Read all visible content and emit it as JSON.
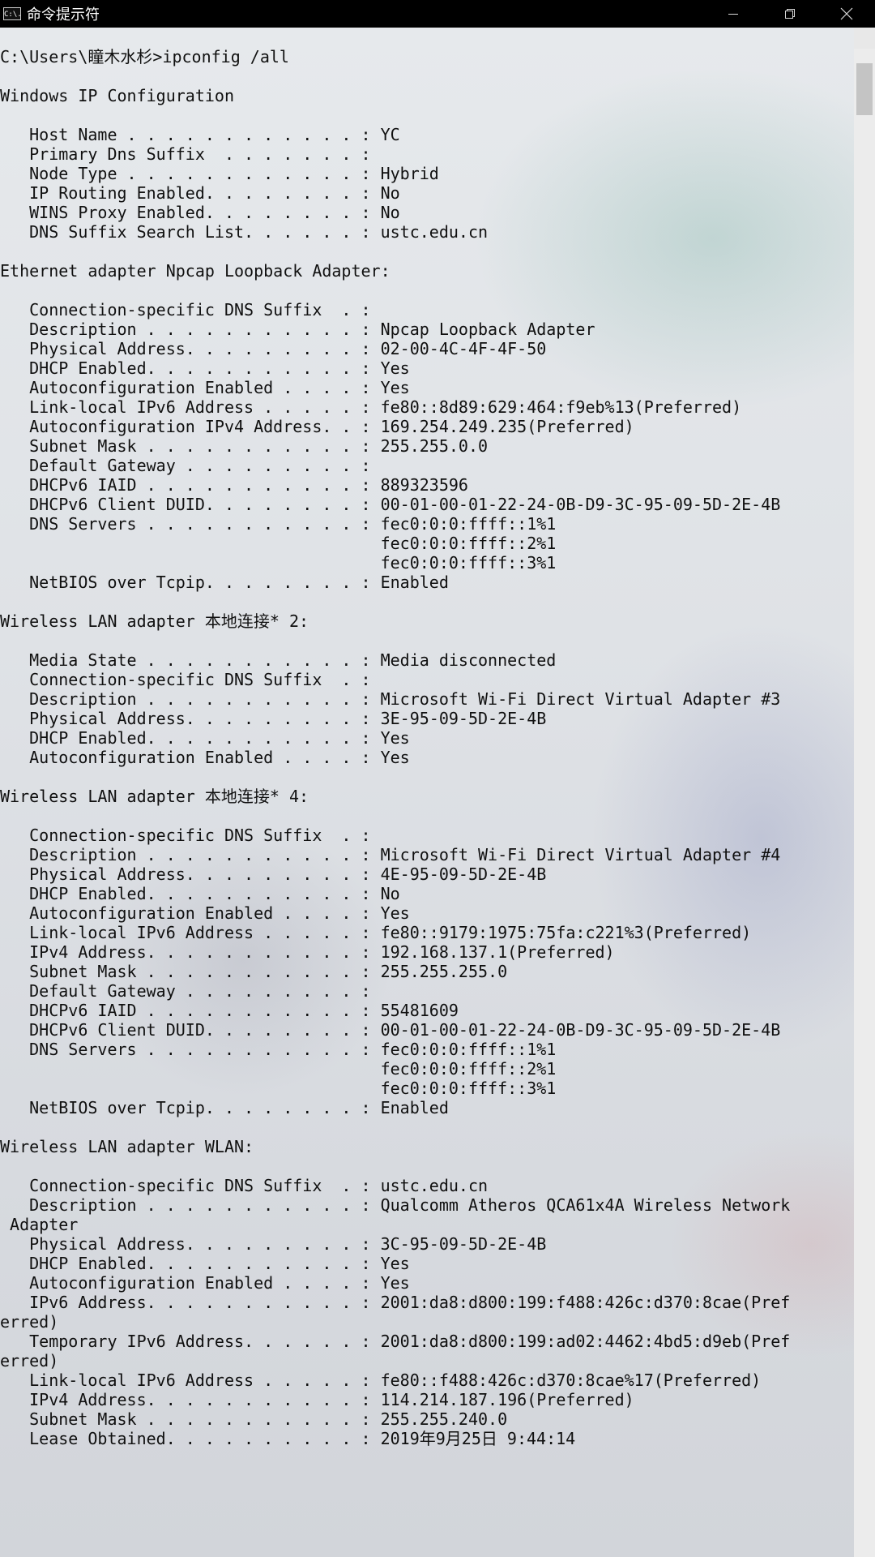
{
  "window": {
    "title": "命令提示符",
    "icon": "cmd-icon",
    "icon_text": "C:\\.",
    "controls": [
      "minimize-icon",
      "restore-icon",
      "close-icon"
    ]
  },
  "console": {
    "lines": [
      "",
      "C:\\Users\\瞳木水杉>ipconfig /all",
      "",
      "Windows IP Configuration",
      "",
      "   Host Name . . . . . . . . . . . . : YC",
      "   Primary Dns Suffix  . . . . . . . :",
      "   Node Type . . . . . . . . . . . . : Hybrid",
      "   IP Routing Enabled. . . . . . . . : No",
      "   WINS Proxy Enabled. . . . . . . . : No",
      "   DNS Suffix Search List. . . . . . : ustc.edu.cn",
      "",
      "Ethernet adapter Npcap Loopback Adapter:",
      "",
      "   Connection-specific DNS Suffix  . :",
      "   Description . . . . . . . . . . . : Npcap Loopback Adapter",
      "   Physical Address. . . . . . . . . : 02-00-4C-4F-4F-50",
      "   DHCP Enabled. . . . . . . . . . . : Yes",
      "   Autoconfiguration Enabled . . . . : Yes",
      "   Link-local IPv6 Address . . . . . : fe80::8d89:629:464:f9eb%13(Preferred)",
      "   Autoconfiguration IPv4 Address. . : 169.254.249.235(Preferred)",
      "   Subnet Mask . . . . . . . . . . . : 255.255.0.0",
      "   Default Gateway . . . . . . . . . :",
      "   DHCPv6 IAID . . . . . . . . . . . : 889323596",
      "   DHCPv6 Client DUID. . . . . . . . : 00-01-00-01-22-24-0B-D9-3C-95-09-5D-2E-4B",
      "   DNS Servers . . . . . . . . . . . : fec0:0:0:ffff::1%1",
      "                                       fec0:0:0:ffff::2%1",
      "                                       fec0:0:0:ffff::3%1",
      "   NetBIOS over Tcpip. . . . . . . . : Enabled",
      "",
      "Wireless LAN adapter 本地连接* 2:",
      "",
      "   Media State . . . . . . . . . . . : Media disconnected",
      "   Connection-specific DNS Suffix  . :",
      "   Description . . . . . . . . . . . : Microsoft Wi-Fi Direct Virtual Adapter #3",
      "   Physical Address. . . . . . . . . : 3E-95-09-5D-2E-4B",
      "   DHCP Enabled. . . . . . . . . . . : Yes",
      "   Autoconfiguration Enabled . . . . : Yes",
      "",
      "Wireless LAN adapter 本地连接* 4:",
      "",
      "   Connection-specific DNS Suffix  . :",
      "   Description . . . . . . . . . . . : Microsoft Wi-Fi Direct Virtual Adapter #4",
      "   Physical Address. . . . . . . . . : 4E-95-09-5D-2E-4B",
      "   DHCP Enabled. . . . . . . . . . . : No",
      "   Autoconfiguration Enabled . . . . : Yes",
      "   Link-local IPv6 Address . . . . . : fe80::9179:1975:75fa:c221%3(Preferred)",
      "   IPv4 Address. . . . . . . . . . . : 192.168.137.1(Preferred)",
      "   Subnet Mask . . . . . . . . . . . : 255.255.255.0",
      "   Default Gateway . . . . . . . . . :",
      "   DHCPv6 IAID . . . . . . . . . . . : 55481609",
      "   DHCPv6 Client DUID. . . . . . . . : 00-01-00-01-22-24-0B-D9-3C-95-09-5D-2E-4B",
      "   DNS Servers . . . . . . . . . . . : fec0:0:0:ffff::1%1",
      "                                       fec0:0:0:ffff::2%1",
      "                                       fec0:0:0:ffff::3%1",
      "   NetBIOS over Tcpip. . . . . . . . : Enabled",
      "",
      "Wireless LAN adapter WLAN:",
      "",
      "   Connection-specific DNS Suffix  . : ustc.edu.cn",
      "   Description . . . . . . . . . . . : Qualcomm Atheros QCA61x4A Wireless Network",
      " Adapter",
      "   Physical Address. . . . . . . . . : 3C-95-09-5D-2E-4B",
      "   DHCP Enabled. . . . . . . . . . . : Yes",
      "   Autoconfiguration Enabled . . . . : Yes",
      "   IPv6 Address. . . . . . . . . . . : 2001:da8:d800:199:f488:426c:d370:8cae(Pref",
      "erred)",
      "   Temporary IPv6 Address. . . . . . : 2001:da8:d800:199:ad02:4462:4bd5:d9eb(Pref",
      "erred)",
      "   Link-local IPv6 Address . . . . . : fe80::f488:426c:d370:8cae%17(Preferred)",
      "   IPv4 Address. . . . . . . . . . . : 114.214.187.196(Preferred)",
      "   Subnet Mask . . . . . . . . . . . : 255.255.240.0",
      "   Lease Obtained. . . . . . . . . . : 2019年9月25日 9:44:14"
    ]
  }
}
